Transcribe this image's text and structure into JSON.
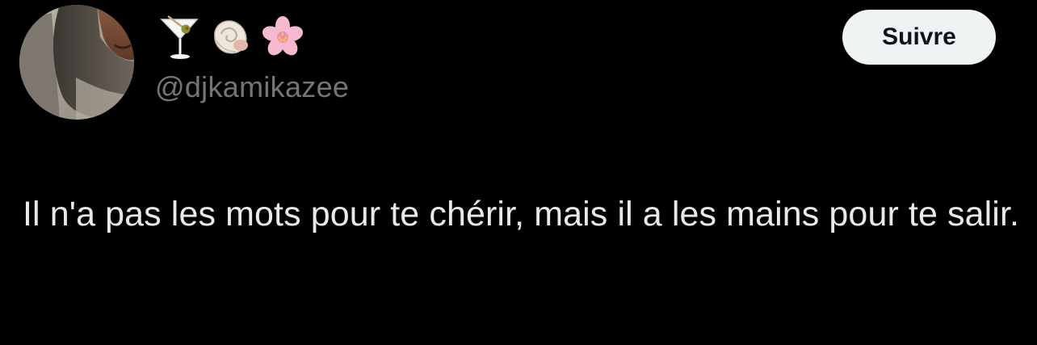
{
  "user": {
    "display_name_emojis": [
      "martini-glass",
      "spiral-shell",
      "cherry-blossom"
    ],
    "handle": "@djkamikazee",
    "avatar": "profile-photo"
  },
  "follow_button": {
    "label": "Suivre"
  },
  "tweet": {
    "text": "Il n'a pas les mots pour te chérir, mais il a les mains pour te salir."
  },
  "colors": {
    "background": "#000000",
    "text": "#e7e9ea",
    "handle": "#71767b",
    "button_bg": "#eff3f4",
    "button_text": "#0f1419"
  }
}
